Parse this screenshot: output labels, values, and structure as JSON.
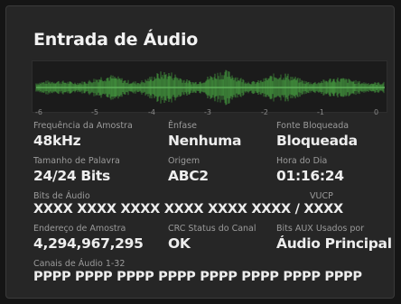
{
  "panel": {
    "title": "Entrada de Áudio"
  },
  "meter": {
    "color": "#3f8a3a",
    "scale": [
      "-6",
      "-5",
      "-4",
      "-3",
      "-2",
      "-1",
      "0"
    ]
  },
  "fields": {
    "sample_rate": {
      "label": "Frequência da Amostra",
      "value": "48kHz"
    },
    "emphasis": {
      "label": "Ênfase",
      "value": "Nenhuma"
    },
    "locked_source": {
      "label": "Fonte Bloqueada",
      "value": "Bloqueada"
    },
    "word_length": {
      "label": "Tamanho de Palavra",
      "value": "24/24 Bits"
    },
    "origin": {
      "label": "Origem",
      "value": "ABC2"
    },
    "time_of_day": {
      "label": "Hora do Dia",
      "value": "01:16:24"
    },
    "audio_bits": {
      "label": "Bits de Áudio",
      "value": "XXXX XXXX XXXX XXXX XXXX XXXX / XXXX"
    },
    "vucp": {
      "label": "VUCP"
    },
    "sample_address": {
      "label": "Endereço de Amostra",
      "value": "4,294,967,295"
    },
    "crc_status": {
      "label": "CRC Status do Canal",
      "value": "OK"
    },
    "aux_bits": {
      "label": "Bits AUX Usados por",
      "value": "Áudio Principal"
    },
    "channels": {
      "label": "Canais de Áudio 1-32",
      "value": "PPPP PPPP PPPP PPPP PPPP PPPP PPPP PPPP"
    }
  }
}
